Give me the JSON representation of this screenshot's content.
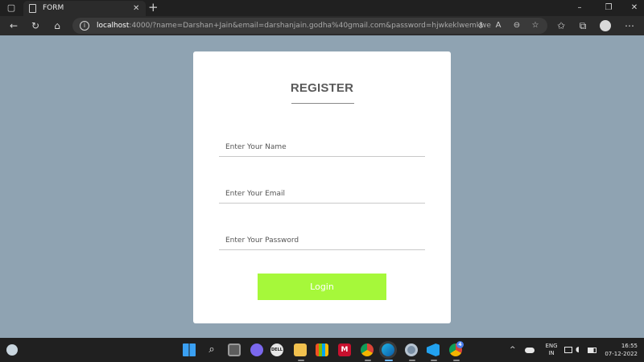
{
  "browser": {
    "tab": {
      "title": "FORM",
      "close": "✕"
    },
    "new_tab": "+",
    "window_controls": {
      "minimize": "–",
      "maximize": "❐",
      "close": "✕"
    },
    "address": {
      "host": "localhost",
      "rest": ":4000/?name=Darshan+Jain&email=darshanjain.godha%40gmail.com&password=hjwkeklwemkwe"
    },
    "icons": [
      "back-arrow-icon",
      "refresh-icon",
      "home-icon",
      "site-info-icon",
      "key-icon",
      "read-aloud-icon",
      "zoom-icon",
      "favorite-star-icon",
      "favorites-icon",
      "collections-icon",
      "profile-icon",
      "more-icon"
    ]
  },
  "form": {
    "heading": "REGISTER",
    "name_placeholder": "Enter Your Name",
    "email_placeholder": "Enter Your Email",
    "password_placeholder": "Enter Your Password",
    "login_label": "Login",
    "accent_color": "#a6f83a",
    "page_background": "#8fa3b2"
  },
  "taskbar": {
    "language": {
      "line1": "ENG",
      "line2": "IN"
    },
    "time": "16:55",
    "date": "07-12-2022",
    "overflow": "^",
    "chrome_badge": "4"
  }
}
